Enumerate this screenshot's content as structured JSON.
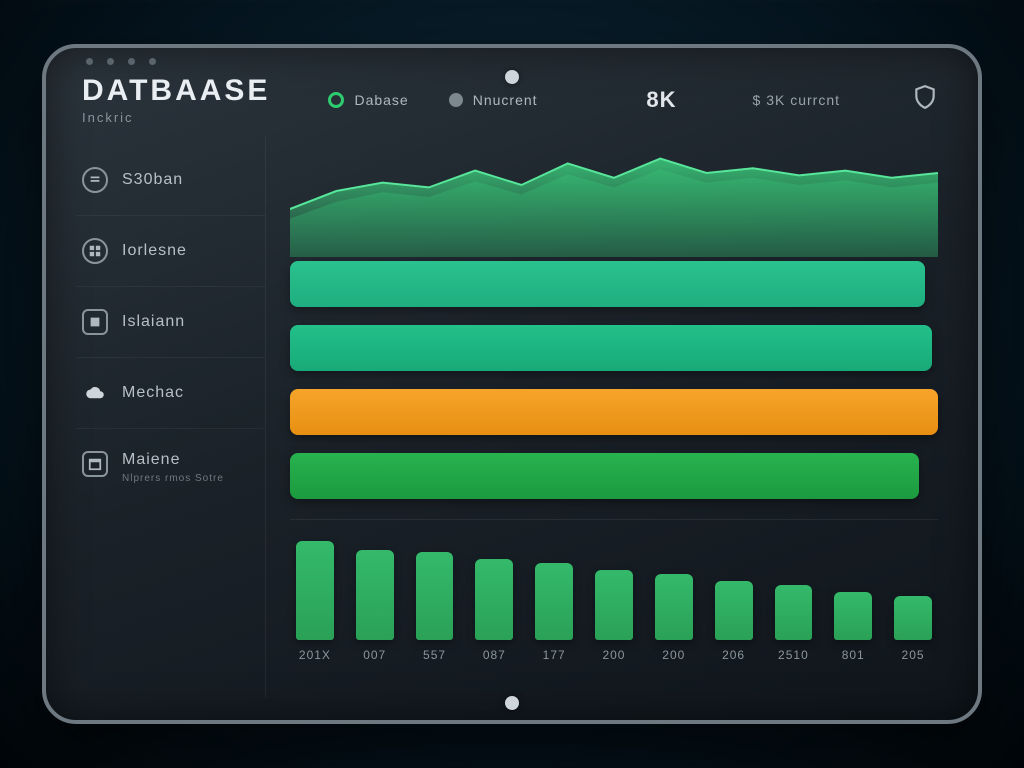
{
  "header": {
    "title": "DATBAASE",
    "subtitle": "Inckric",
    "stat_k": "8K",
    "stat_current": "$ 3K currcnt"
  },
  "legend": {
    "items": [
      {
        "label": "Dabase"
      },
      {
        "label": "Nnucrent"
      }
    ]
  },
  "sidebar": {
    "items": [
      {
        "label": "S30ban"
      },
      {
        "label": "Iorlesne"
      },
      {
        "label": "Islaiann"
      },
      {
        "label": "Mechac"
      },
      {
        "label": "Maiene",
        "sub": "Nlprers rmos Sotre"
      }
    ]
  },
  "xaxis": [
    "201X",
    "007",
    "557",
    "087",
    "177",
    "200",
    "200",
    "206",
    "2510",
    "801",
    "205"
  ],
  "chart_data": [
    {
      "type": "area",
      "title": "",
      "series": [
        {
          "name": "Dabase",
          "values": [
            40,
            55,
            62,
            58,
            72,
            60,
            78,
            66,
            82,
            70,
            74,
            68,
            72,
            66,
            70
          ]
        },
        {
          "name": "Nnucrent",
          "values": [
            32,
            46,
            54,
            50,
            63,
            52,
            69,
            58,
            73,
            62,
            66,
            60,
            64,
            58,
            62
          ]
        }
      ],
      "ylim": [
        0,
        100
      ]
    },
    {
      "type": "bar",
      "orientation": "horizontal",
      "categories": [
        "S30ban",
        "Iorlesne",
        "Islaiann",
        "Mechac"
      ],
      "values": [
        98,
        99,
        100,
        97
      ],
      "colors": [
        "#22c08a",
        "#22c08a",
        "#f09a1f",
        "#24ad4a"
      ],
      "ylim": [
        0,
        100
      ]
    },
    {
      "type": "bar",
      "categories": [
        "201X",
        "007",
        "557",
        "087",
        "177",
        "200",
        "200",
        "206",
        "2510",
        "801",
        "205"
      ],
      "values": [
        90,
        82,
        80,
        74,
        70,
        64,
        60,
        54,
        50,
        44,
        40
      ],
      "ylim": [
        0,
        100
      ],
      "color": "#2fb161"
    }
  ]
}
